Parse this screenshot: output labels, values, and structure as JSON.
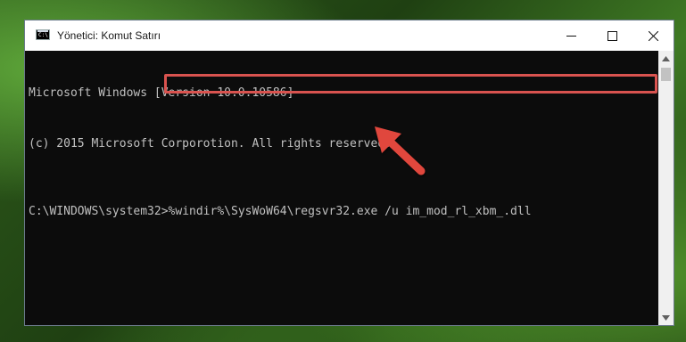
{
  "window": {
    "title": "Yönetici: Komut Satırı",
    "app_icon_text": "C:\\",
    "controls": {
      "minimize_icon": "minimize-icon",
      "maximize_icon": "maximize-icon",
      "close_icon": "close-icon"
    }
  },
  "console": {
    "lines": [
      "Microsoft Windows [Version 10.0.10586]",
      "(c) 2015 Microsoft Corporotion. All rights reserved."
    ],
    "prompt": "C:\\WINDOWS\\system32>",
    "command": "%windir%\\SysWoW64\\regsvr32.exe /u im_mod_rl_xbm_.dll"
  },
  "annotations": {
    "highlight_color": "#d9534f",
    "arrow_color": "#e0463d",
    "arrow_icon": "pointer-arrow-icon"
  },
  "colors": {
    "console_bg": "#0c0c0c",
    "console_text": "#c0c0c0",
    "titlebar_bg": "#ffffff"
  }
}
